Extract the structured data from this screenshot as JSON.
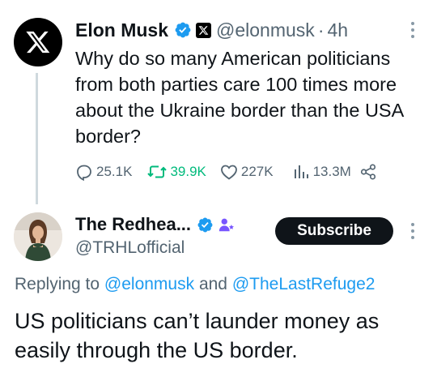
{
  "tweet": {
    "author_name": "Elon Musk",
    "handle": "@elonmusk",
    "separator": "·",
    "time": "4h",
    "text": "Why do so many American politicians from both parties care 100 times more about the Ukraine border than the USA border?",
    "stats": {
      "replies": "25.1K",
      "reposts": "39.9K",
      "likes": "227K",
      "views": "13.3M"
    },
    "repost_color": "#00ba7c",
    "avatar_icon": "x-logo-icon"
  },
  "reply": {
    "author_name": "The Redhea...",
    "handle": "@TRHLofficial",
    "subscribe_label": "Subscribe",
    "replying_prefix": "Replying to",
    "mention_1": "@elonmusk",
    "and_word": "and",
    "mention_2": "@TheLastRefuge2",
    "text": "US politicians can’t launder money as easily through the US border.",
    "mention_color": "#1d9bf0"
  },
  "colors": {
    "verified_blue": "#1d9bf0",
    "muted": "#536471",
    "badge_purple": "#7856ff"
  }
}
